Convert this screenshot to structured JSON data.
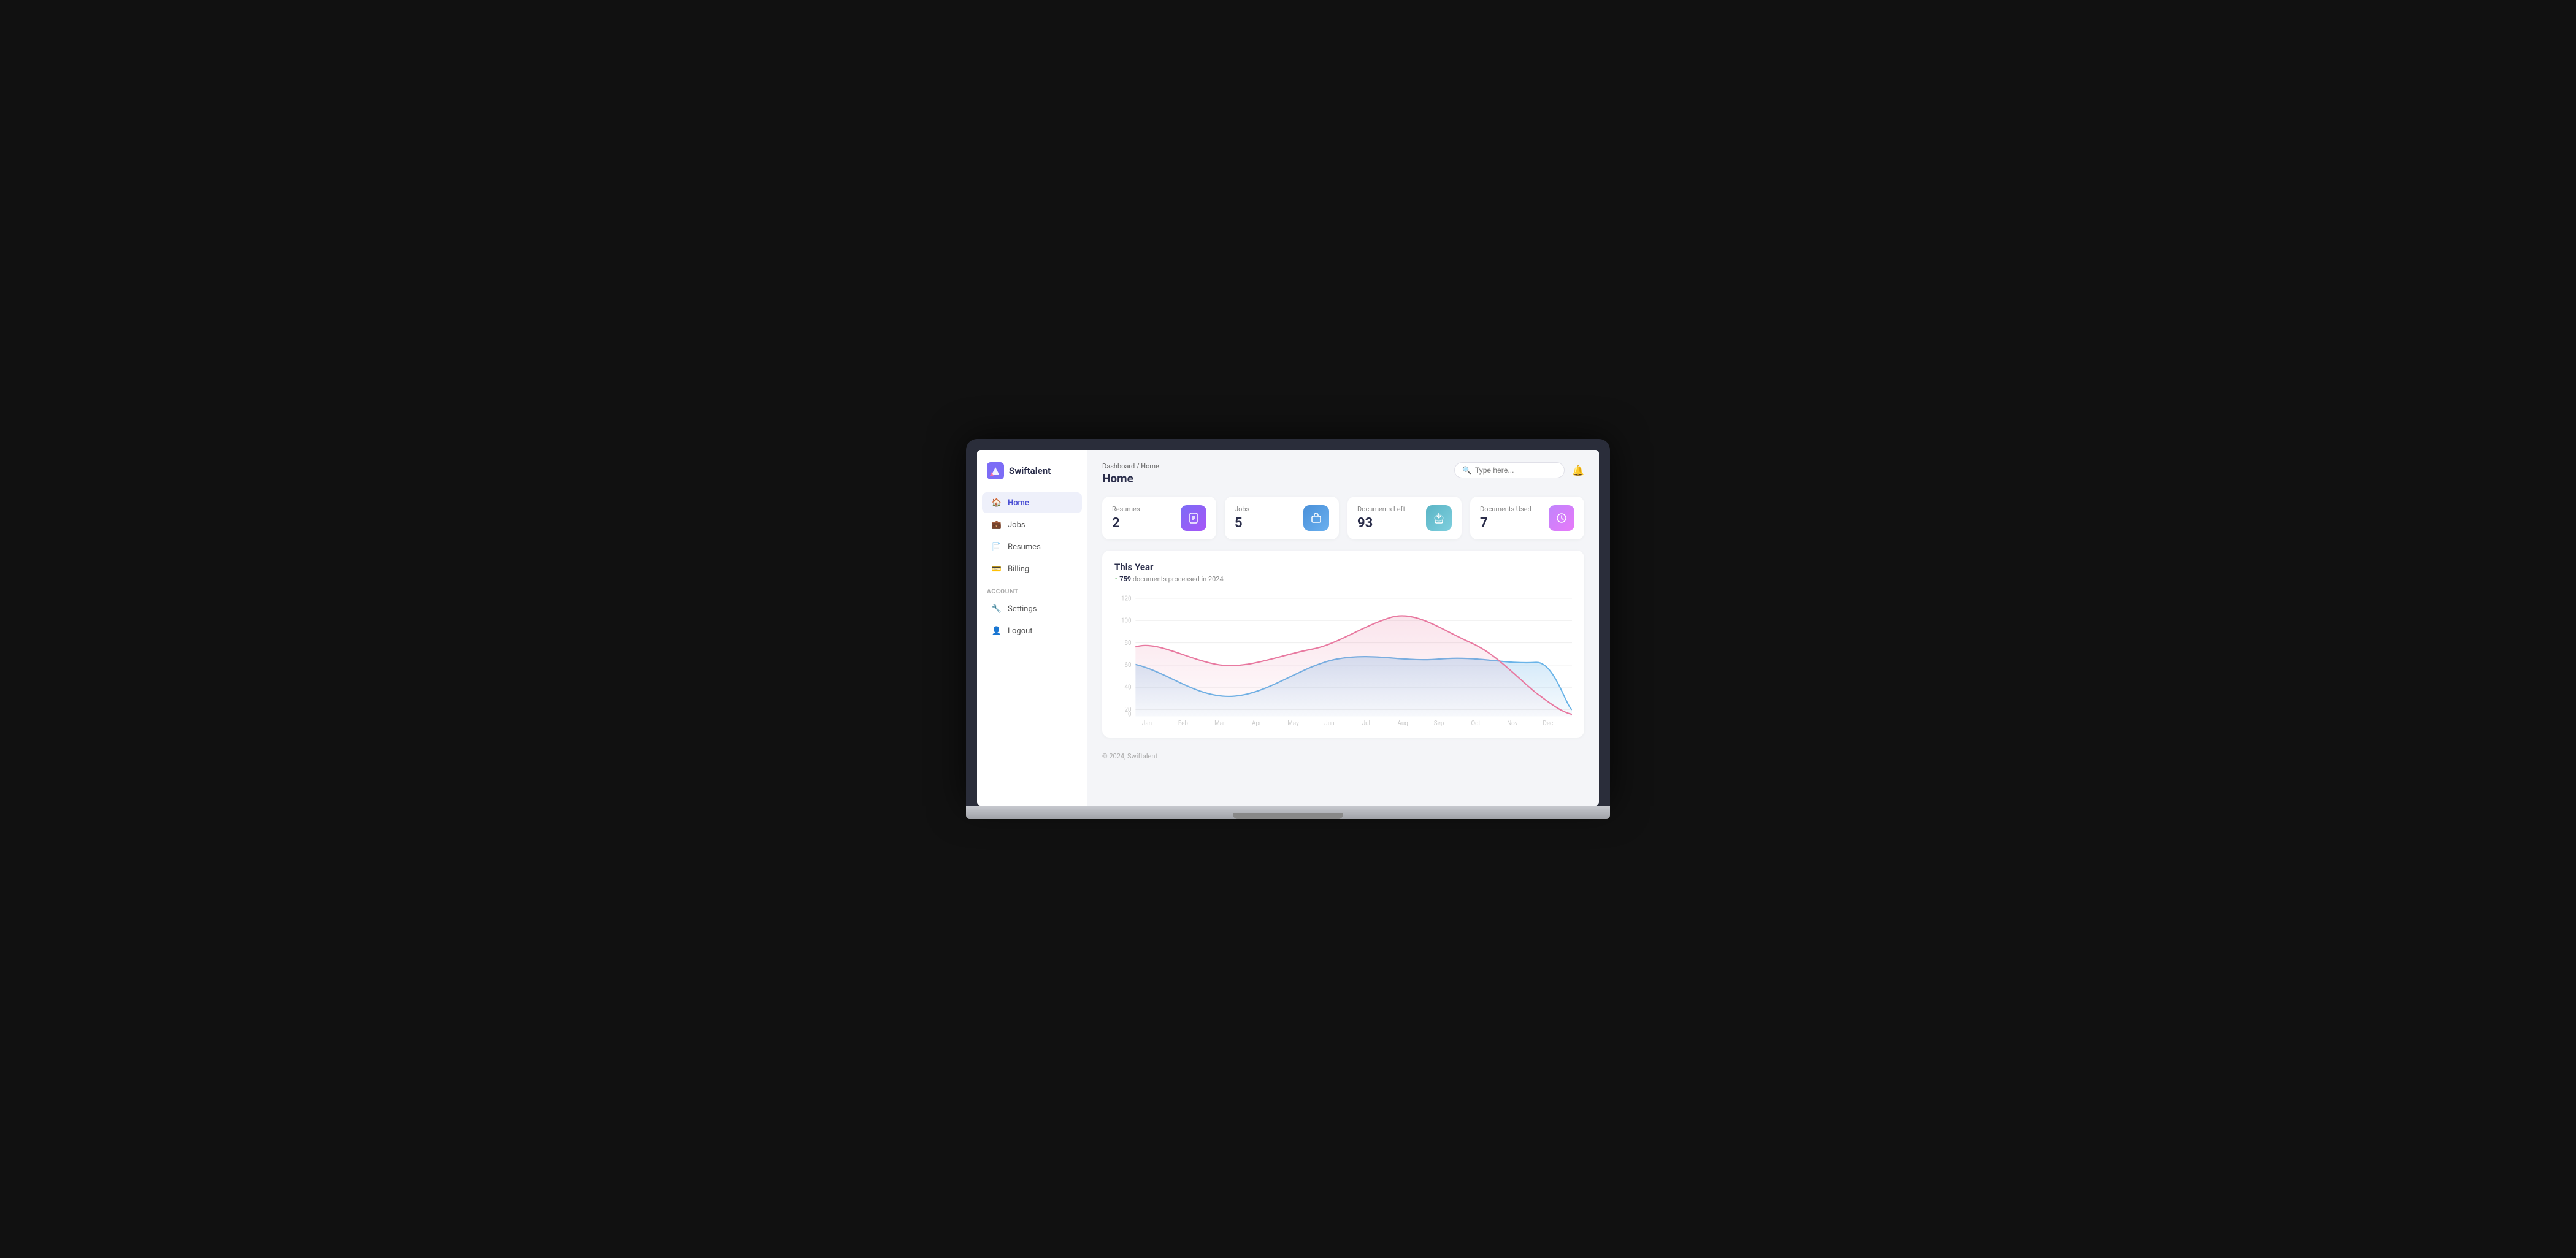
{
  "app": {
    "name": "Swiftalent"
  },
  "breadcrumb": {
    "parent": "Dashboard",
    "separator": "/",
    "current": "Home"
  },
  "page": {
    "title": "Home"
  },
  "search": {
    "placeholder": "Type here..."
  },
  "sidebar": {
    "nav_items": [
      {
        "id": "home",
        "label": "Home",
        "icon": "🏠",
        "active": true
      },
      {
        "id": "jobs",
        "label": "Jobs",
        "icon": "💼",
        "active": false
      },
      {
        "id": "resumes",
        "label": "Resumes",
        "icon": "📄",
        "active": false
      },
      {
        "id": "billing",
        "label": "Billing",
        "icon": "💳",
        "active": false
      }
    ],
    "account_section_label": "ACCOUNT",
    "account_items": [
      {
        "id": "settings",
        "label": "Settings",
        "icon": "🔧",
        "active": false
      },
      {
        "id": "logout",
        "label": "Logout",
        "icon": "👤",
        "active": false
      }
    ]
  },
  "stats": [
    {
      "label": "Resumes",
      "value": "2",
      "icon": "📋",
      "icon_class": "icon-purple"
    },
    {
      "label": "Jobs",
      "value": "5",
      "icon": "💼",
      "icon_class": "icon-blue"
    },
    {
      "label": "Documents Left",
      "value": "93",
      "icon": "☁",
      "icon_class": "icon-teal"
    },
    {
      "label": "Documents Used",
      "value": "7",
      "icon": "⚙",
      "icon_class": "icon-pink"
    }
  ],
  "chart": {
    "title": "This Year",
    "subtitle_count": "759",
    "subtitle_text": "documents processed in 2024",
    "y_labels": [
      "0",
      "20",
      "40",
      "60",
      "80",
      "100",
      "120"
    ],
    "x_labels": [
      "Jan",
      "Feb",
      "Mar",
      "Apr",
      "May",
      "Jun",
      "Jul",
      "Aug",
      "Sep",
      "Oct",
      "Nov",
      "Dec"
    ]
  },
  "footer": {
    "text": "© 2024, Swiftalent"
  }
}
